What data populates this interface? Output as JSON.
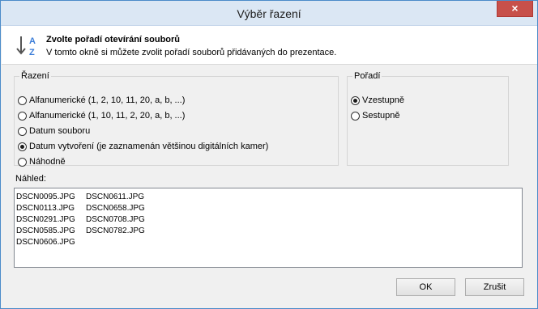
{
  "window": {
    "title": "Výběr řazení",
    "close_glyph": "×"
  },
  "header": {
    "title": "Zvolte pořadí otevírání souborů",
    "description": "V tomto okně si můžete zvolit pořadí souborů přidávaných do prezentace.",
    "icon": "sort-az-icon",
    "icon_letters": [
      "A",
      "Z"
    ]
  },
  "sort_group": {
    "legend": "Řazení",
    "options": [
      {
        "label": "Alfanumerické (1, 2, 10, 11, 20, a, b, ...)",
        "checked": false
      },
      {
        "label": "Alfanumerické (1, 10, 11, 2, 20, a, b, ...)",
        "checked": false
      },
      {
        "label": "Datum souboru",
        "checked": false
      },
      {
        "label": "Datum vytvoření (je zaznamenán většinou digitálních kamer)",
        "checked": true
      },
      {
        "label": "Náhodně",
        "checked": false
      }
    ]
  },
  "order_group": {
    "legend": "Pořadí",
    "options": [
      {
        "label": "Vzestupně",
        "checked": true
      },
      {
        "label": "Sestupně",
        "checked": false
      }
    ]
  },
  "preview": {
    "label": "Náhled:",
    "columns": [
      [
        "DSCN0095.JPG",
        "DSCN0113.JPG",
        "DSCN0291.JPG",
        "DSCN0585.JPG",
        "DSCN0606.JPG"
      ],
      [
        "DSCN0611.JPG",
        "DSCN0658.JPG",
        "DSCN0708.JPG",
        "DSCN0782.JPG"
      ]
    ]
  },
  "buttons": {
    "ok": "OK",
    "cancel": "Zrušit"
  },
  "colors": {
    "title_bar": "#dbe7f4",
    "close_button": "#c7504a",
    "icon_accent": "#3b7dd8"
  }
}
